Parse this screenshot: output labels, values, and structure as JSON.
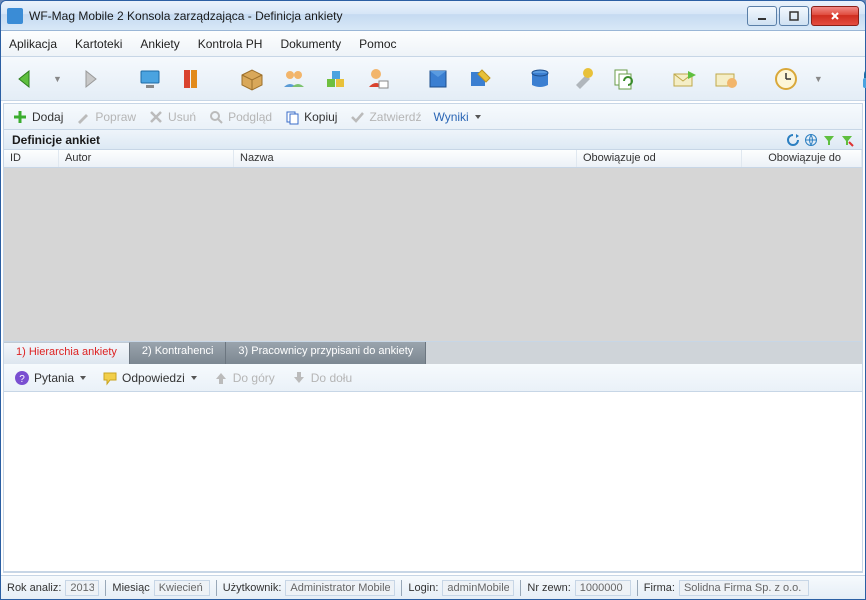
{
  "title": "WF-Mag Mobile 2 Konsola zarządzająca - Definicja ankiety",
  "menu": [
    "Aplikacja",
    "Kartoteki",
    "Ankiety",
    "Kontrola PH",
    "Dokumenty",
    "Pomoc"
  ],
  "actions": {
    "dodaj": "Dodaj",
    "popraw": "Popraw",
    "usun": "Usuń",
    "podglad": "Podgląd",
    "kopiuj": "Kopiuj",
    "zatwierdz": "Zatwierdź",
    "wyniki": "Wyniki"
  },
  "section_title": "Definicje ankiet",
  "columns": {
    "id": "ID",
    "autor": "Autor",
    "nazwa": "Nazwa",
    "od": "Obowiązuje od",
    "do": "Obowiązuje do"
  },
  "tabs": {
    "t1": "1) Hierarchia ankiety",
    "t2": "2) Kontrahenci",
    "t3": "3) Pracownicy przypisani do ankiety"
  },
  "panel_actions": {
    "pytania": "Pytania",
    "odpowiedzi": "Odpowiedzi",
    "dogory": "Do góry",
    "dodolu": "Do dołu"
  },
  "status": {
    "rok_label": "Rok analiz:",
    "rok_value": "2013",
    "miesiac_label": "Miesiąc",
    "miesiac_value": "Kwiecień",
    "uzytkownik_label": "Użytkownik:",
    "uzytkownik_value": "Administrator Mobile",
    "login_label": "Login:",
    "login_value": "adminMobile",
    "nrzewn_label": "Nr zewn:",
    "nrzewn_value": "1000000",
    "firma_label": "Firma:",
    "firma_value": "Solidna Firma Sp. z o.o."
  }
}
